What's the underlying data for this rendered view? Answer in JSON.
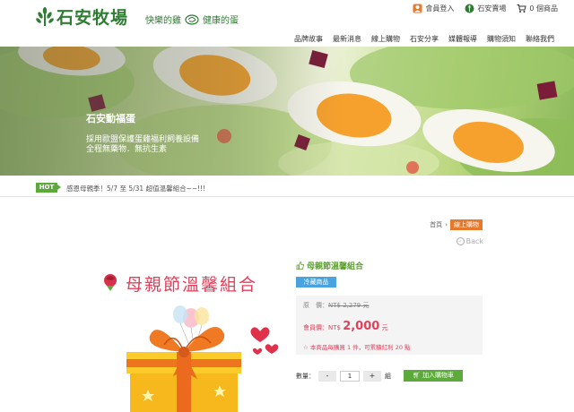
{
  "header": {
    "logo_text": "石安牧場",
    "slogan_left": "快樂的雞",
    "slogan_right": "健康的蛋",
    "top_links": [
      {
        "label": "會員登入",
        "icon": "member-icon"
      },
      {
        "label": "石安賣場",
        "icon": "store-icon"
      },
      {
        "label": "0 個商品",
        "icon": "cart-icon"
      }
    ],
    "nav": [
      "品牌故事",
      "最新消息",
      "線上購物",
      "石安分享",
      "媒體報導",
      "購物須知",
      "聯絡我們"
    ]
  },
  "banner": {
    "title": "石安動福蛋",
    "desc1": "採用歐盟保護蛋雞福利飼養設備",
    "desc2": "全程無藥物．無抗生素"
  },
  "ticker": {
    "badge": "HOT",
    "text": "感恩母親季！5/7 至 5/31 超值溫馨組合~~!!!"
  },
  "breadcrumb": {
    "home": "首頁",
    "separator": "›",
    "current": "線上購物"
  },
  "back": {
    "label": "Back"
  },
  "product": {
    "image_caption": "母親節溫馨組合",
    "title": "母親節溫馨組合",
    "tag": "冷藏商品",
    "original_label": "原　價：",
    "original_price": "NT$ 2,279 元",
    "member_label": "會員價：NT$",
    "member_price": "2,000",
    "member_unit": "元",
    "bonus_text": "本商品每購買 1 件，可累積紅利 20 點",
    "qty_label": "數量：",
    "qty_minus": "-",
    "qty_value": "1",
    "qty_plus": "+",
    "qty_unit": "組",
    "add_cart": "加入購物車"
  },
  "colors": {
    "brand_green": "#2e7d32",
    "accent_orange": "#e8782a",
    "price_red": "#e0405a",
    "tag_blue": "#4aa3df",
    "button_green": "#5cab3a"
  }
}
